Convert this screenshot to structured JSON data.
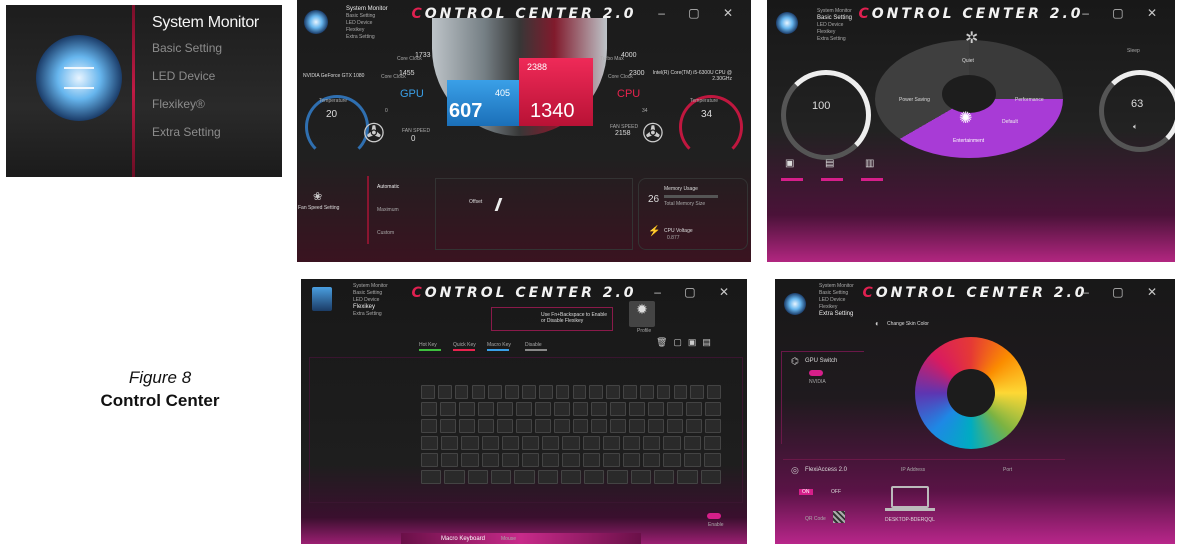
{
  "brand": {
    "title_prefix": "C",
    "title_rest": "ONTROL CENTER 2.0",
    "window_controls": "‒ ▢ ✕",
    "accent": "#e8234e",
    "pink": "#d61f8a",
    "blue": "#3aa0e8"
  },
  "caption": {
    "figure": "Figure 8",
    "title": "Control Center"
  },
  "menu_zoom": {
    "items": [
      {
        "label": "System Monitor",
        "active": true
      },
      {
        "label": "Basic Setting",
        "active": false
      },
      {
        "label": "LED Device",
        "active": false
      },
      {
        "label": "Flexikey®",
        "active": false
      },
      {
        "label": "Extra Setting",
        "active": false
      }
    ]
  },
  "sysmon": {
    "menu": [
      "System Monitor",
      "Basic Setting",
      "LED Device",
      "Flexikey",
      "Extra Setting"
    ],
    "gpu_name": "NVIDIA GeForce GTX 1080",
    "cpu_name": "Intel(R) Core(TM) i5-6300U CPU @ 2.30GHz",
    "gpu_label": "GPU",
    "cpu_label": "CPU",
    "gpu_core_clock_label": "Core Clock",
    "gpu_core_clock": "1733",
    "gpu_mem_clock_label": "Core Clock",
    "gpu_mem_clock": "1455",
    "cpu_turbo_label": "Turbo Max",
    "cpu_turbo": "4000",
    "cpu_clock_label": "Core Clock",
    "cpu_clock": "2300",
    "unit_mhz": "MHz",
    "gpu_temp_label": "Temperature",
    "gpu_temp": "20",
    "cpu_temp_label": "Temperature",
    "cpu_temp": "34",
    "gpu_fan_label": "FAN SPEED",
    "gpu_fan": "0",
    "cpu_fan_label": "FAN SPEED",
    "cpu_fan": "2158",
    "unit_rpm": "RPM",
    "gpu_percent": "0",
    "cpu_percent": "34",
    "gpu_big": "607",
    "gpu_small": "405",
    "cpu_big": "1340",
    "cpu_small": "2388",
    "fan_speed_setting": "Fan Speed Setting",
    "fan_modes": [
      "Automatic",
      "Maximum",
      "Custom"
    ],
    "offset_label": "Offset",
    "memory_usage_label": "Memory Usage",
    "memory_usage": "26",
    "memory_total_label": "Total Memory Size",
    "cpu_voltage_label": "CPU Voltage",
    "cpu_voltage": "0.877"
  },
  "basic": {
    "menu": [
      "System Monitor",
      "Basic Setting",
      "LED Device",
      "Flexikey",
      "Extra Setting"
    ],
    "left_value": "100",
    "right_value": "63",
    "segments": [
      "Quiet",
      "Power Saving",
      "Performance",
      "Entertainment"
    ],
    "default_label": "Default",
    "sleep_label": "Sleep",
    "bottom_icons": [
      "Calibrate",
      "Touchpad",
      "LCD Sleep",
      "Bluetooth",
      "Camera",
      "Wifi"
    ]
  },
  "flexikey": {
    "menu": [
      "System Monitor",
      "Basic Setting",
      "LED Device",
      "Flexikey",
      "Extra Setting"
    ],
    "instruction": "Use Fn+Backspace to Enable or Disable Flexikey",
    "profile_label": "Profile",
    "tabs": [
      "Hot Key",
      "Quick Key",
      "Macro Key",
      "Disable"
    ],
    "bottom_tabs": [
      "Macro Keyboard",
      "Mouse"
    ],
    "enable_label": "Enable"
  },
  "extra": {
    "menu": [
      "System Monitor",
      "Basic Setting",
      "LED Device",
      "Flexikey",
      "Extra Setting"
    ],
    "change_skin": "Change Skin Color",
    "gpu_switch": "GPU Switch",
    "gpu_mode": "NVIDIA",
    "flexiaccess": "FlexiAccess 2.0",
    "on_label": "ON",
    "off_label": "OFF",
    "ip_label": "IP Address",
    "port_label": "Port",
    "qr_label": "QR Code",
    "device_name": "DESKTOP-BDERQQL"
  }
}
